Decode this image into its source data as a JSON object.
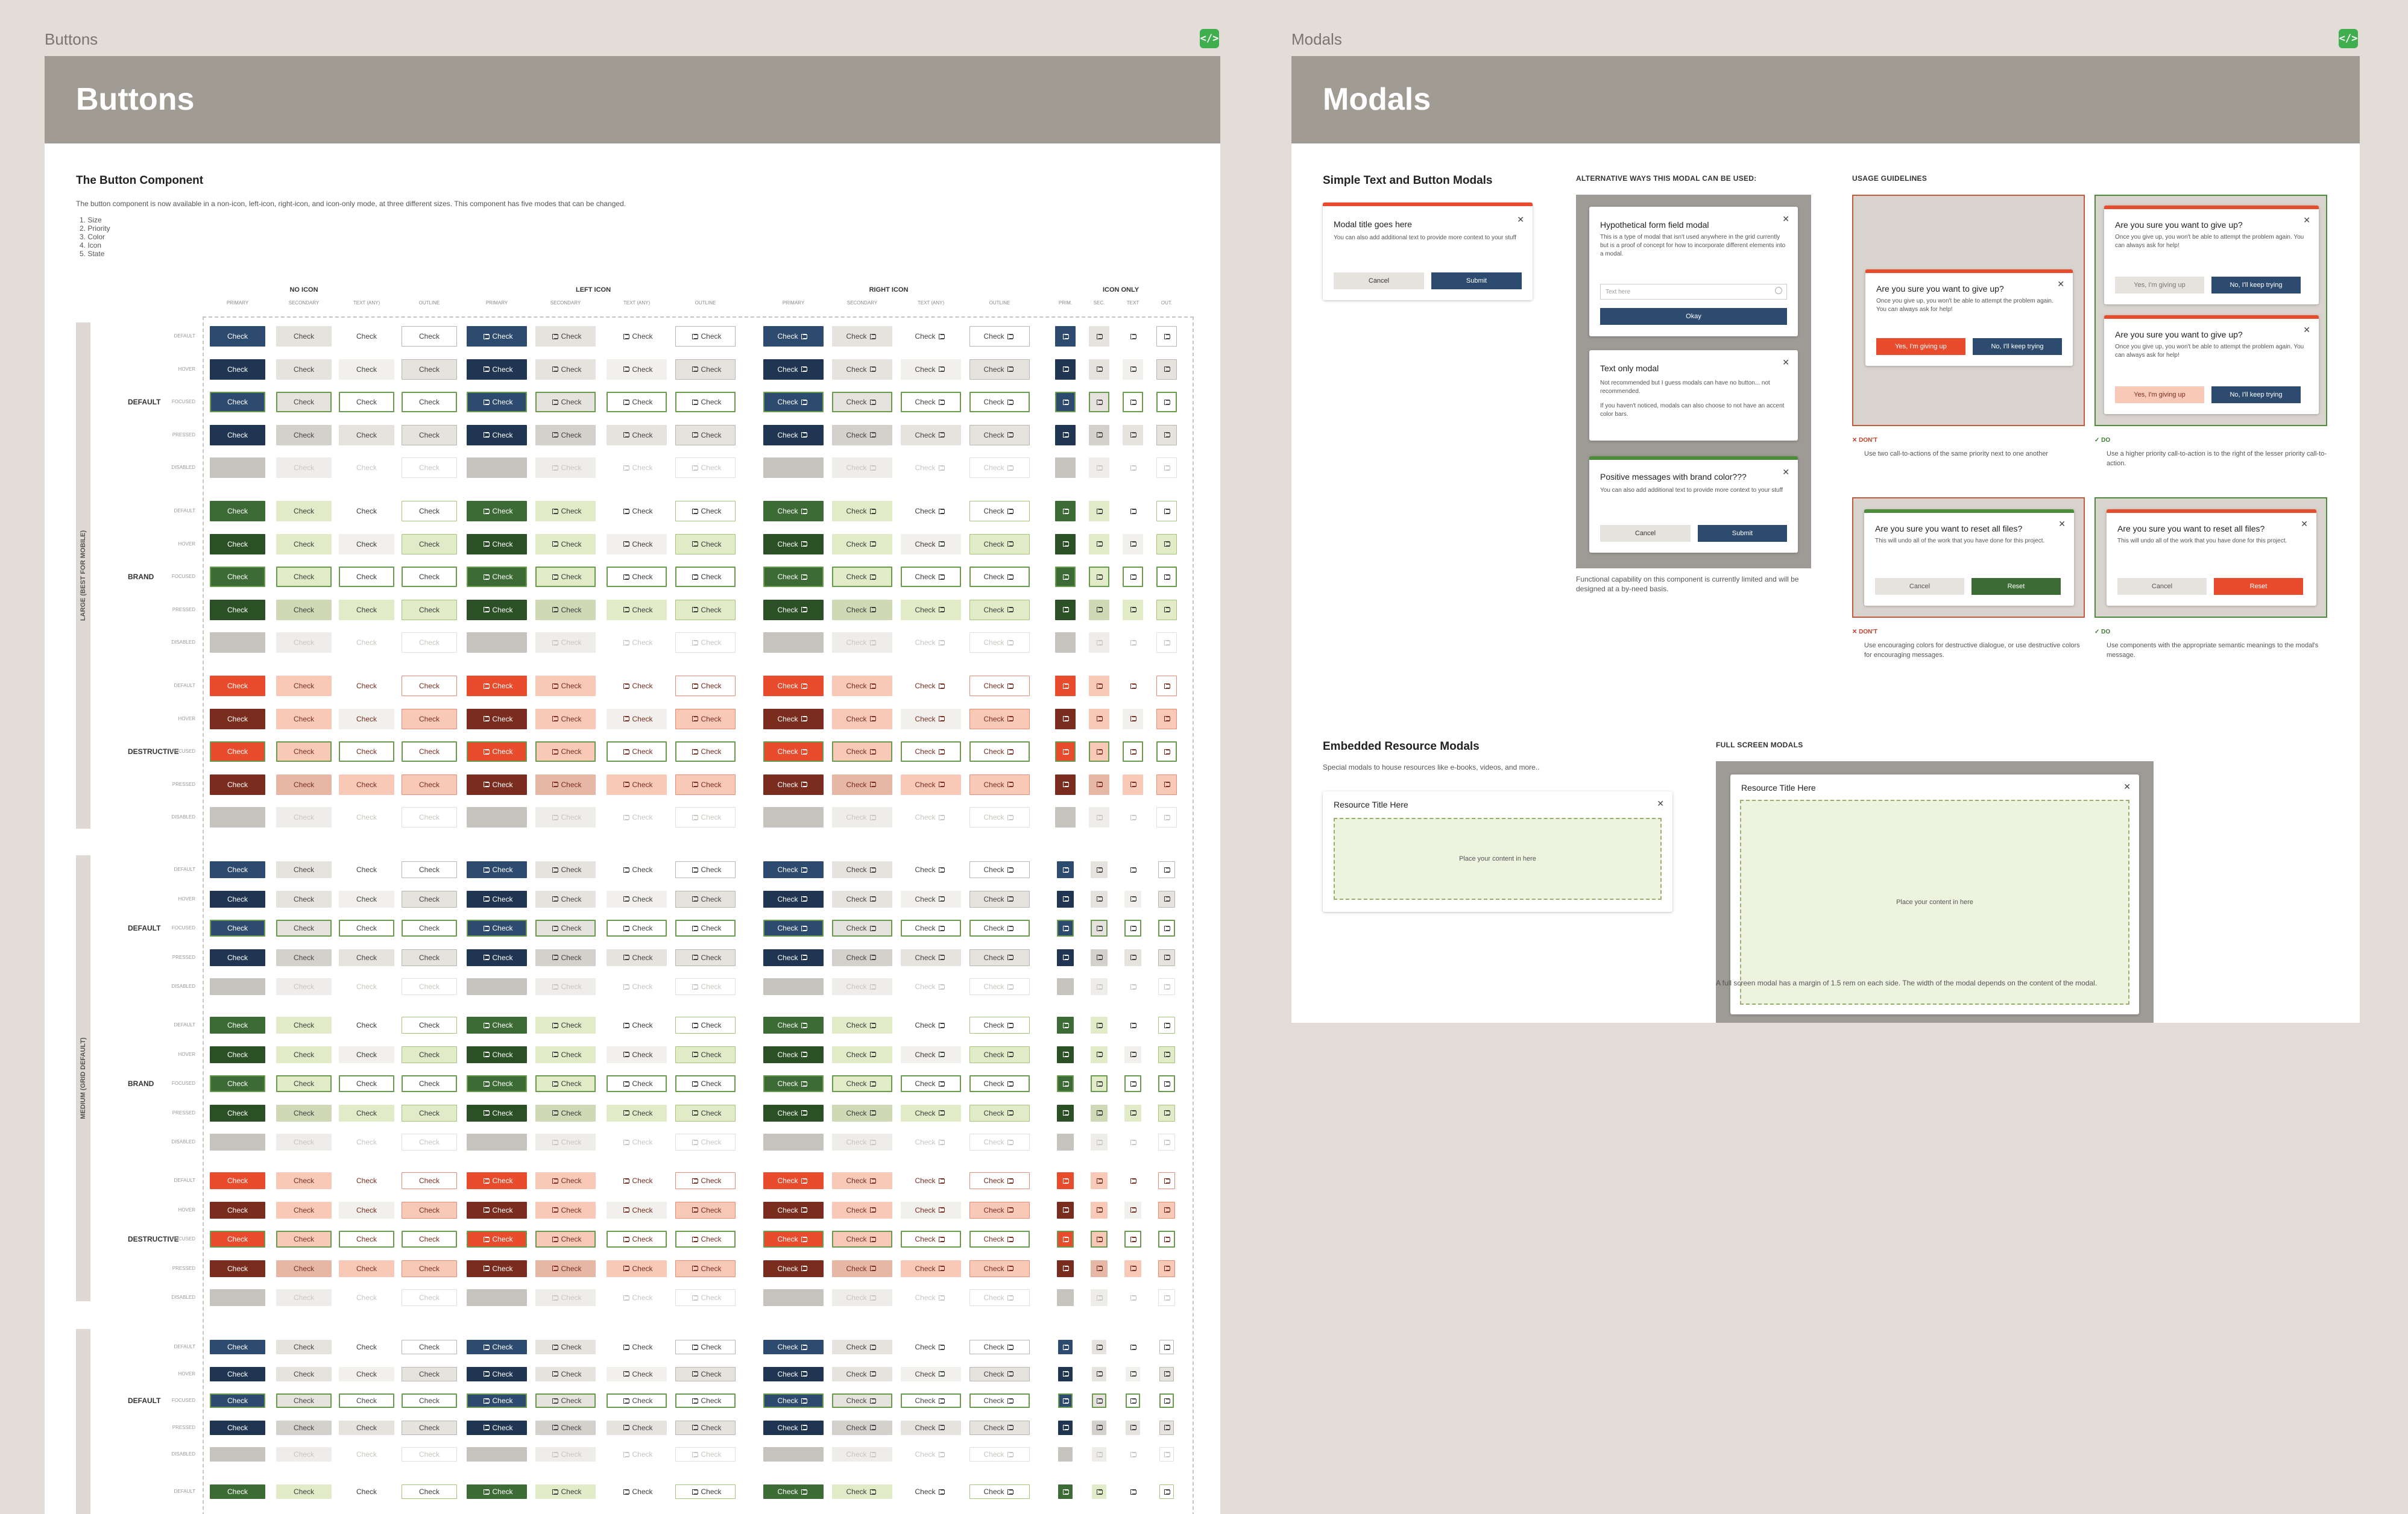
{
  "frames": {
    "buttons_label": "Buttons",
    "modals_label": "Modals",
    "code_icon_glyph": "</>"
  },
  "buttons_page": {
    "title": "Buttons",
    "section_title": "The Button Component",
    "intro": "The button component is now available in a non-icon, left-icon, right-icon, and icon-only mode, at three different sizes. This component has five modes that can be changed.",
    "modes": [
      "1. Size",
      "2. Priority",
      "3. Color",
      "4. Icon",
      "5. State"
    ],
    "column_groups": [
      "NO ICON",
      "LEFT ICON",
      "RIGHT ICON",
      "ICON ONLY"
    ],
    "column_subheaders": [
      "PRIMARY",
      "SECONDARY",
      "TEXT (ANY)",
      "OUTLINE"
    ],
    "icon_only_subheaders": [
      "PRIM.",
      "SEC.",
      "TEXT",
      "OUT."
    ],
    "sizes": [
      {
        "name": "LARGE (BEST FOR MOBILE)"
      },
      {
        "name": "MEDIUM (GRID DEFAULT)"
      }
    ],
    "color_groups": [
      "DEFAULT",
      "BRAND",
      "DESTRUCTIVE"
    ],
    "states": [
      "DEFAULT",
      "HOVER",
      "FOCUSED",
      "PRESSED",
      "DISABLED"
    ],
    "button_label": "Check",
    "colors": {
      "default_primary": "#2d4b6e",
      "default_primary_dark": "#1f3552",
      "brand_primary": "#3d6b35",
      "brand_primary_dark": "#2c5026",
      "destructive_primary": "#e94b2d",
      "destructive_primary_dark": "#7a2d1e",
      "secondary_bg": "#e6e3de",
      "brand_secondary_bg": "#e1ebc7",
      "destructive_secondary_bg": "#f7c9b6",
      "disabled_bg": "#c7c4bf",
      "focus_ring": "#6a9a4d"
    }
  },
  "modals_page": {
    "title": "Modals",
    "simple": {
      "title": "Simple Text and Button Modals",
      "modal_title": "Modal title goes here",
      "modal_body": "You can also add additional text to provide more context to your stuff",
      "cancel": "Cancel",
      "submit": "Submit"
    },
    "alternative": {
      "heading": "ALTERNATIVE WAYS THIS MODAL CAN BE USED:",
      "form_title": "Hypothetical form field modal",
      "form_body": "This is a type of modal that isn't used anywhere in the grid currently but is a proof of concept for how to incorporate different elements into a modal.",
      "form_placeholder": "Text here",
      "form_button": "Okay",
      "text_title": "Text only modal",
      "text_body_1": "Not recommended but I guess modals can have no button... not recommended.",
      "text_body_2": "If you haven't noticed, modals can also choose to not have an accent color bars.",
      "brand_title": "Positive messages with brand color???",
      "brand_body": "You can also add additional text to provide more context to your stuff",
      "brand_cancel": "Cancel",
      "brand_submit": "Submit",
      "caption": "Functional capability on this component is currently limited and will be designed at a by-need basis."
    },
    "usage": {
      "heading": "USAGE GUIDELINES",
      "give_up_title": "Are you sure you want to give up?",
      "give_up_body": "Once you give up, you won't be able to attempt the problem again. You can always ask for help!",
      "giving_up": "Yes, I'm giving up",
      "keep_trying": "No, I'll keep trying",
      "reset_title": "Are you sure you want to reset all files?",
      "reset_body": "This will undo all of the work that you have done for this project.",
      "cancel": "Cancel",
      "reset": "Reset",
      "dont_label": "DON'T",
      "do_label": "DO",
      "dont_1": "Use two call-to-actions of the same priority next to one another",
      "do_1": "Use a higher priority call-to-action is to the right of the lesser priority call-to-action.",
      "dont_2": "Use encouraging colors for destructive dialogue, or use destructive colors for encouraging messages.",
      "do_2": "Use components with the appropriate semantic meanings to the modal's message."
    },
    "embedded": {
      "title": "Embedded Resource Modals",
      "body": "Special modals to house resources like e-books, videos, and more..",
      "resource_title": "Resource Title Here",
      "content_placeholder": "Place your content in here"
    },
    "fullscreen": {
      "heading": "FULL SCREEN MODALS",
      "resource_title": "Resource Title Here",
      "content_placeholder": "Place your content in here",
      "caption": "A full screen modal has a margin of 1.5 rem on each side. The width of the modal depends on the content of the modal."
    }
  }
}
